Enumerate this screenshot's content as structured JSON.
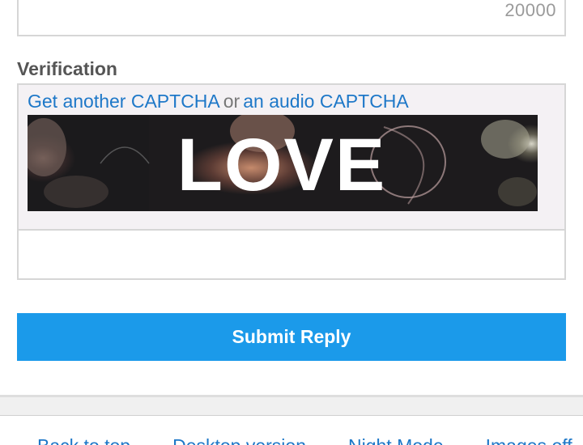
{
  "counter": {
    "value": "20000"
  },
  "verification": {
    "label": "Verification",
    "another_captcha_link": "Get another CAPTCHA",
    "or_text": "or",
    "audio_captcha_link": "an audio CAPTCHA",
    "captcha_image_text": "LOVE",
    "captcha_input_placeholder": ""
  },
  "submit": {
    "label": "Submit Reply"
  },
  "footer": {
    "links": [
      "Back to top",
      "Desktop version",
      "Night Mode",
      "Images off"
    ]
  },
  "colors": {
    "accent": "#1b9aea",
    "link": "#1e78c8",
    "label": "#555555",
    "captcha_bg": "#f4f1f4"
  }
}
